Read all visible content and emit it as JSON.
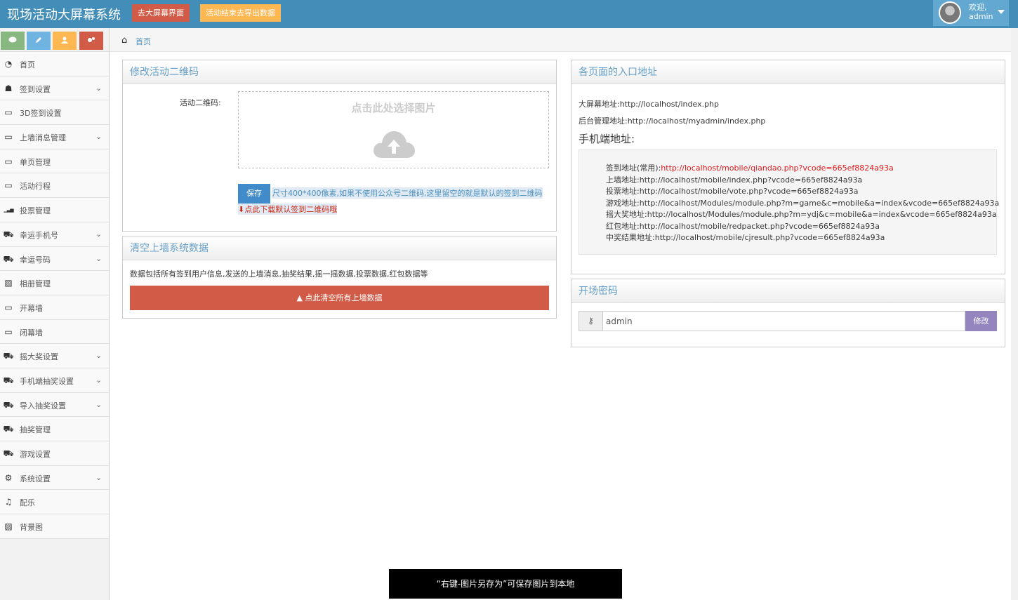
{
  "header": {
    "brand": "现场活动大屏幕系统",
    "btn_big_screen": "去大屏幕界面",
    "btn_export": "活动结束去导出数据",
    "welcome": "欢迎,",
    "user": "admin"
  },
  "sidebar": {
    "items": [
      {
        "label": "首页",
        "icon": "dashboard-icon",
        "arrow": false
      },
      {
        "label": "签到设置",
        "icon": "users-icon",
        "arrow": true
      },
      {
        "label": "3D签到设置",
        "icon": "desktop-icon",
        "arrow": false
      },
      {
        "label": "上墙消息管理",
        "icon": "desktop-icon",
        "arrow": true
      },
      {
        "label": "单页管理",
        "icon": "desktop-icon",
        "arrow": false
      },
      {
        "label": "活动行程",
        "icon": "desktop-icon",
        "arrow": false
      },
      {
        "label": "投票管理",
        "icon": "signal-icon",
        "arrow": false
      },
      {
        "label": "幸运手机号",
        "icon": "gift-icon",
        "arrow": true
      },
      {
        "label": "幸运号码",
        "icon": "gift-icon",
        "arrow": true
      },
      {
        "label": "相册管理",
        "icon": "picture-icon",
        "arrow": false
      },
      {
        "label": "开幕墙",
        "icon": "desktop-icon",
        "arrow": false
      },
      {
        "label": "闭幕墙",
        "icon": "desktop-icon",
        "arrow": false
      },
      {
        "label": "摇大奖设置",
        "icon": "gift-icon",
        "arrow": true
      },
      {
        "label": "手机端抽奖设置",
        "icon": "gift-icon",
        "arrow": true
      },
      {
        "label": "导入抽奖设置",
        "icon": "gift-icon",
        "arrow": true
      },
      {
        "label": "抽奖管理",
        "icon": "gift-icon",
        "arrow": false
      },
      {
        "label": "游戏设置",
        "icon": "gift-icon",
        "arrow": false
      },
      {
        "label": "系统设置",
        "icon": "cog-icon",
        "arrow": true
      },
      {
        "label": "配乐",
        "icon": "music-icon",
        "arrow": false
      },
      {
        "label": "背景图",
        "icon": "picture-icon",
        "arrow": false
      }
    ]
  },
  "breadcrumb": {
    "home": "首页"
  },
  "qrcode_widget": {
    "title": "修改活动二维码",
    "label": "活动二维码:",
    "upload_text": "点击此处选择图片",
    "save": "保存",
    "hint": "尺寸400*400像素,如果不使用公众号二维码,这里留空的就是默认的签到二维码",
    "download": "点此下载默认签到二维码哦"
  },
  "clear_widget": {
    "title": "清空上墙系统数据",
    "desc": "数据包括所有签到用户信息,发送的上墙消息,抽奖结果,摇一摇数据,投票数据,红包数据等",
    "button": "点此清空所有上墙数据"
  },
  "urls_widget": {
    "title": "各页面的入口地址",
    "big_screen": "大屏幕地址:http://localhost/index.php",
    "admin": "后台管理地址:http://localhost/myadmin/index.php",
    "mobile_title": "手机端地址:",
    "mobile": [
      {
        "label": "签到地址(常用):",
        "url": "http://localhost/mobile/qiandao.php?vcode=665ef8824a93a",
        "highlight": true
      },
      {
        "label": "上墙地址:",
        "url": "http://localhost/mobile/index.php?vcode=665ef8824a93a",
        "highlight": false
      },
      {
        "label": "投票地址:",
        "url": "http://localhost/mobile/vote.php?vcode=665ef8824a93a",
        "highlight": false
      },
      {
        "label": "游戏地址:",
        "url": "http://localhost/Modules/module.php?m=game&c=mobile&a=index&vcode=665ef8824a93a",
        "highlight": false
      },
      {
        "label": "摇大奖地址:",
        "url": "http://localhost/Modules/module.php?m=ydj&c=mobile&a=index&vcode=665ef8824a93a",
        "highlight": false
      },
      {
        "label": "红包地址:",
        "url": "http://localhost/mobile/redpacket.php?vcode=665ef8824a93a",
        "highlight": false
      },
      {
        "label": "中奖结果地址:",
        "url": "http://localhost/mobile/cjresult.php?vcode=665ef8824a93a",
        "highlight": false
      }
    ]
  },
  "password_widget": {
    "title": "开场密码",
    "value": "admin",
    "button": "修改"
  },
  "toast": "“右键-图片另存为”可保存图片到本地"
}
